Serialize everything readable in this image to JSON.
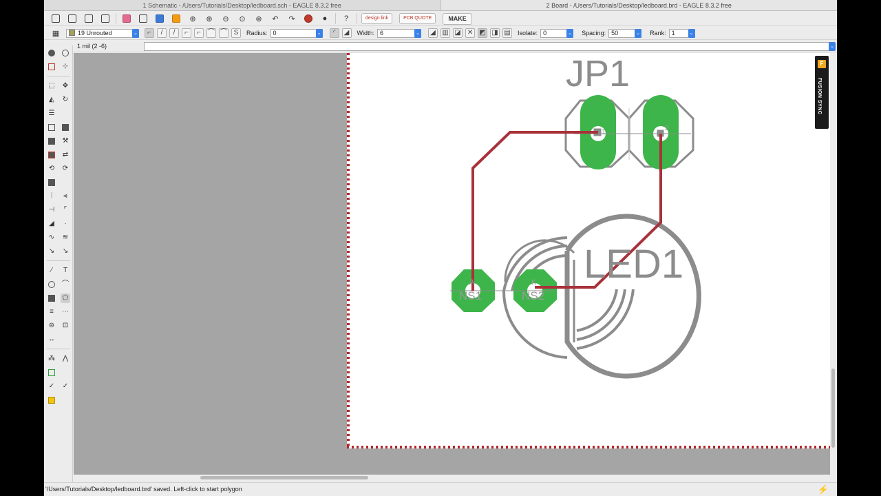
{
  "tabs": [
    {
      "label": "1 Schematic - /Users/Tutorials/Desktop/ledboard.sch - EAGLE 8.3.2 free"
    },
    {
      "label": "2 Board - /Users/Tutorials/Desktop/ledboard.brd - EAGLE 8.3.2 free"
    }
  ],
  "toolbar": {
    "designlink_label": "design link",
    "pcbquote_label": "PCB QUOTE",
    "make_label": "MAKE"
  },
  "params": {
    "layer": "19 Unrouted",
    "radius_label": "Radius:",
    "radius_value": "0",
    "width_label": "Width:",
    "width_value": "6",
    "isolate_label": "Isolate:",
    "isolate_value": "0",
    "spacing_label": "Spacing:",
    "spacing_value": "50",
    "rank_label": "Rank:",
    "rank_value": "1"
  },
  "command": {
    "coordinates": "1 mil (2 -6)",
    "input_value": ""
  },
  "board": {
    "jp1_label": "JP1",
    "led1_label": "LED1",
    "pad_labels": [
      "NS1",
      "NS2"
    ],
    "anode_label": "A",
    "cathode_label": "K",
    "pin_labels": [
      "1",
      "2"
    ],
    "colors": {
      "pad": "#3db54a",
      "trace": "#a8323a",
      "silk": "#8c8c8c",
      "outline": "#b5272d"
    }
  },
  "fusion_sync": {
    "label": "FUSION SYNC",
    "logo": "F"
  },
  "status": {
    "message": "'/Users/Tutorials/Desktop/ledboard.brd' saved. Left-click to start polygon"
  }
}
